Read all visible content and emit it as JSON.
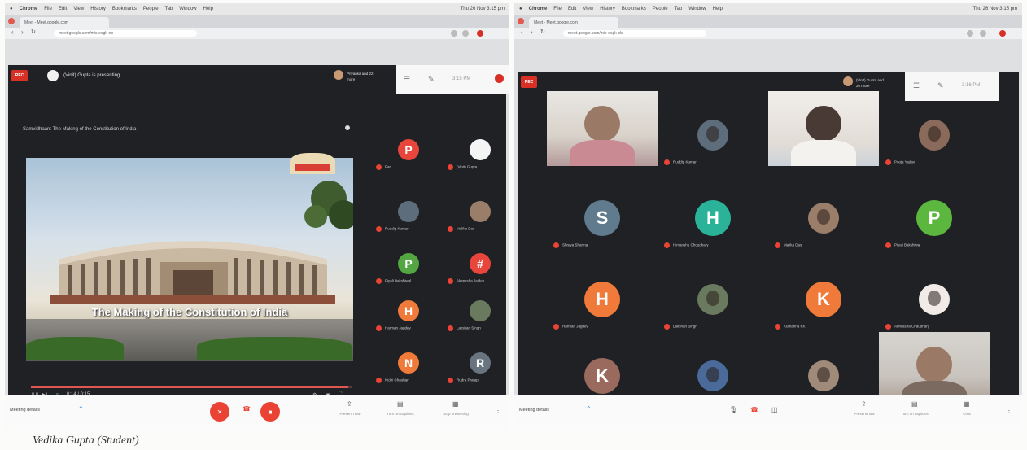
{
  "left": {
    "browser": {
      "menu": [
        "Chrome",
        "File",
        "Edit",
        "View",
        "History",
        "Bookmarks",
        "People",
        "Tab",
        "Window",
        "Help"
      ],
      "clock": "Thu 26 Nov 3:15 pm",
      "tab_title": "Meet - Meet.google.com",
      "url": "meet.google.com/mic-ecgk-ob"
    },
    "meet": {
      "rec_label": "REC",
      "presenter_title": "(Vinit) Gupta is presenting",
      "pinned_name": "Priyanka and 22 more",
      "time": "3:15 PM",
      "slide_title": "Samvidhaan: The Making of the Constitution of India",
      "video_caption": "The Making of the Constitution of India",
      "video_time": "0:14 / 0:15",
      "participants": [
        {
          "name": "Pari",
          "letter": "P",
          "color": "#e8453c"
        },
        {
          "name": "(Vinit) Gupta",
          "letter": "",
          "color": "#f4f4f4"
        },
        {
          "name": "Ruddip Kumar",
          "letter": "",
          "color": "#5d6d7b"
        },
        {
          "name": "Malika Das",
          "letter": "",
          "color": "#9b7e6a"
        },
        {
          "name": "Piyali Bakshiwal",
          "letter": "P",
          "color": "#53a642"
        },
        {
          "name": "Akanksha Jaidev",
          "letter": "#",
          "color": "#e8453c"
        },
        {
          "name": "Harman Jagdev",
          "letter": "H",
          "color": "#f07a3a"
        },
        {
          "name": "Lakshan Singh",
          "letter": "",
          "color": "#6a7a5e"
        },
        {
          "name": "Nidhi Chauhan",
          "letter": "N",
          "color": "#f07a3a"
        },
        {
          "name": "Rudra Pratap",
          "letter": "R",
          "color": "#687480"
        }
      ]
    },
    "bottom": {
      "meeting_details": "Meeting details",
      "present_now": "Present now",
      "turn_on_captions": "Turn on captions",
      "stop_presenting": "Stop presenting"
    }
  },
  "right": {
    "browser": {
      "menu": [
        "Chrome",
        "File",
        "Edit",
        "View",
        "History",
        "Bookmarks",
        "People",
        "Tab",
        "Window",
        "Help"
      ],
      "clock": "Thu 26 Nov 3:15 pm",
      "tab_title": "Meet - Meet.google.com",
      "url": "meet.google.com/mic-ecgk-ob"
    },
    "meet": {
      "rec_label": "REC",
      "pinned_name": "(Vinit) Gupta and 20 more",
      "time": "3:16 PM",
      "participants": [
        {
          "name": "",
          "letter": "",
          "kind": "camera"
        },
        {
          "name": "Ruddip Kumar",
          "letter": "",
          "kind": "photo",
          "color": "#5d6d7b"
        },
        {
          "name": "",
          "letter": "",
          "kind": "camera"
        },
        {
          "name": "Pooja Yadav",
          "letter": "",
          "kind": "photo",
          "color": "#8a6a5a"
        },
        {
          "name": "Shreya Sharma",
          "letter": "S",
          "kind": "letter",
          "color": "#607a8e"
        },
        {
          "name": "Himanshu Choudhary",
          "letter": "H",
          "kind": "letter",
          "color": "#2bb39a"
        },
        {
          "name": "Malika Das",
          "letter": "",
          "kind": "photo",
          "color": "#9b7e6a"
        },
        {
          "name": "Piyali Bakshiwal",
          "letter": "P",
          "kind": "letter",
          "color": "#5cb73e"
        },
        {
          "name": "Harman Jagdev",
          "letter": "H",
          "kind": "letter",
          "color": "#f07a3a"
        },
        {
          "name": "Lakshan Singh",
          "letter": "",
          "kind": "photo",
          "color": "#6a7a5e"
        },
        {
          "name": "Kumarina KK",
          "letter": "K",
          "kind": "letter",
          "color": "#f07a3a"
        },
        {
          "name": "Abhilasha Chaudhary",
          "letter": "",
          "kind": "photo",
          "color": "#f0ebe6"
        },
        {
          "name": "Khushi Pillay",
          "letter": "K",
          "kind": "letter",
          "color": "#9a6a5e"
        },
        {
          "name": "Mahesh Rao",
          "letter": "",
          "kind": "photo",
          "color": "#4a6a9a"
        },
        {
          "name": "Priyanka Malik",
          "letter": "",
          "kind": "photo",
          "color": "#a08a7a"
        },
        {
          "name": "Aarav Srivastava",
          "letter": "",
          "kind": "camera"
        }
      ]
    },
    "bottom": {
      "meeting_details": "Meeting details",
      "present_now": "Present now",
      "turn_on_captions": "Turn on captions",
      "chat": "Chat"
    }
  },
  "caption": "Vedika Gupta (Student)"
}
